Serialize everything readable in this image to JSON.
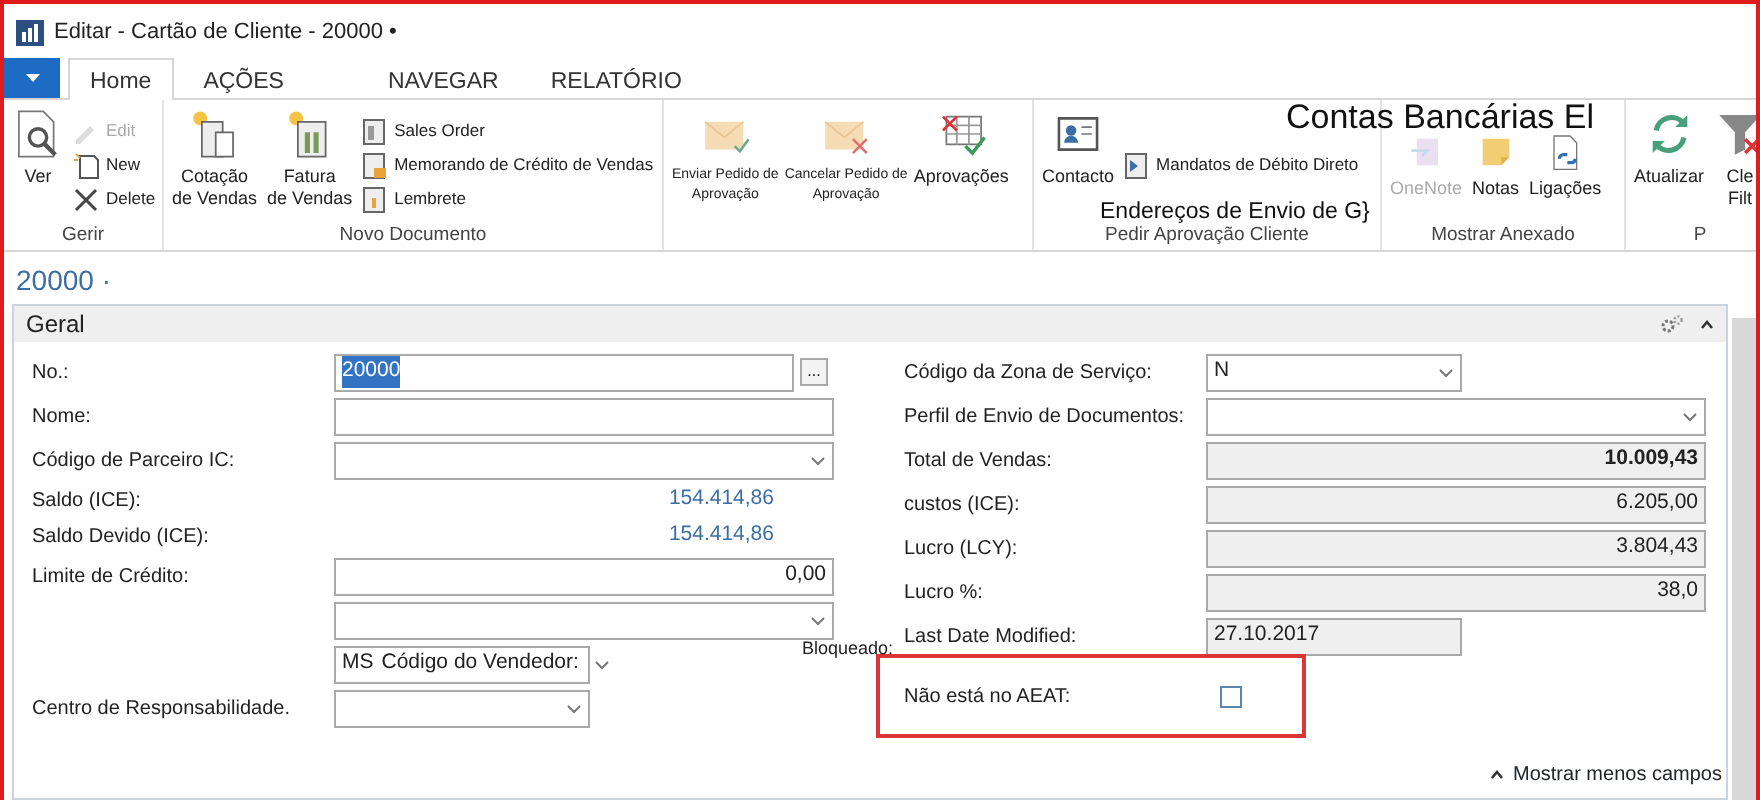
{
  "window": {
    "title": "Editar - Cartão de Cliente - 20000 •"
  },
  "ribbon_tabs": [
    {
      "label": "Home",
      "selected": true
    },
    {
      "label": "AÇÕES",
      "selected": false
    },
    {
      "label": "NAVEGAR",
      "selected": false
    },
    {
      "label": "RELATÓRIO",
      "selected": false
    }
  ],
  "ribbon_groups": [
    {
      "label": "Gerir",
      "items": [
        {
          "kind": "large",
          "lines": [
            "Ver"
          ],
          "disabled": false
        },
        {
          "kind": "small",
          "lines": [
            "Edit"
          ],
          "disabled": true
        },
        {
          "kind": "small",
          "lines": [
            "New"
          ],
          "disabled": false
        },
        {
          "kind": "small",
          "lines": [
            "Delete"
          ],
          "disabled": false
        }
      ]
    },
    {
      "label": "Novo Documento",
      "items": [
        {
          "kind": "large",
          "lines": [
            "Cotação",
            "de Vendas"
          ],
          "disabled": false
        },
        {
          "kind": "large",
          "lines": [
            "Fatura",
            "de Vendas"
          ],
          "disabled": false
        },
        {
          "kind": "small",
          "lines": [
            "Sales Order"
          ],
          "disabled": false
        },
        {
          "kind": "small",
          "lines": [
            "Memorando de Crédito de Vendas"
          ],
          "disabled": false
        },
        {
          "kind": "small",
          "lines": [
            "Lembrete"
          ],
          "disabled": false
        }
      ]
    },
    {
      "items": [
        {
          "kind": "large-fine",
          "lines": [
            "Enviar Pedido de",
            "Aprovação"
          ],
          "disabled": false
        },
        {
          "kind": "large-fine",
          "lines": [
            "Cancelar Pedido de",
            "Aprovação"
          ],
          "disabled": false
        },
        {
          "kind": "large",
          "lines": [
            "Aprovações"
          ],
          "disabled": false
        }
      ]
    },
    {
      "label": "Pedir Aprovação Cliente",
      "items": [
        {
          "kind": "large",
          "lines": [
            "Contacto"
          ],
          "disabled": false
        },
        {
          "kind": "small",
          "lines": [
            "Mandatos de Débito Direto"
          ],
          "disabled": false
        }
      ]
    },
    {
      "label": "Mostrar Anexado",
      "items": [
        {
          "kind": "large",
          "lines": [
            "OneNote"
          ],
          "disabled": true
        },
        {
          "kind": "large",
          "lines": [
            "Notas"
          ],
          "disabled": false
        },
        {
          "kind": "large",
          "lines": [
            "Ligações"
          ],
          "disabled": false
        }
      ]
    },
    {
      "label": "P",
      "items": [
        {
          "kind": "large",
          "lines": [
            "Atualizar"
          ],
          "disabled": false
        },
        {
          "kind": "large",
          "lines": [
            "Cle",
            "Filt"
          ],
          "disabled": false
        }
      ]
    }
  ],
  "ribbon_overlay_texts": [
    "Contas Bancárias El",
    "Endereços de Envio de G}"
  ],
  "page_title": "20000 ·",
  "panel": {
    "title": "Geral",
    "left_fields": [
      {
        "kind": "lookup",
        "label": "No.:",
        "value": "20000",
        "value_selected": true,
        "button": "..."
      },
      {
        "kind": "text",
        "label": "Nome:"
      },
      {
        "kind": "dropdown",
        "label": "Código de Parceiro IC:"
      },
      {
        "kind": "amount",
        "label": "Saldo (ICE):",
        "value": "154.414,86"
      },
      {
        "kind": "amount",
        "label": "Saldo Devido (ICE):",
        "value": "154.414,86"
      },
      {
        "kind": "number",
        "label": "Limite de Crédito:",
        "value": "0,00"
      },
      {
        "kind": "dropdown"
      },
      {
        "kind": "dropdown-short",
        "value": "MS",
        "inner_label": "Código do Vendedor:"
      },
      {
        "kind": "dropdown-short",
        "label": "Centro de Responsabilidade."
      }
    ],
    "right_fields": [
      {
        "kind": "dropdown-short",
        "label": "Código da Zona de Serviço:",
        "value": "N"
      },
      {
        "kind": "dropdown",
        "label": "Perfil de Envio de Documentos:"
      },
      {
        "kind": "readonly",
        "label": "Total de Vendas:",
        "value": "10.009,43",
        "bold": true
      },
      {
        "kind": "readonly",
        "label": "custos (ICE):",
        "value": "6.205,00"
      },
      {
        "kind": "readonly",
        "label": "Lucro (LCY):",
        "value": "3.804,43"
      },
      {
        "kind": "readonly",
        "label": "Lucro %:",
        "value": "38,0"
      },
      {
        "kind": "readonly-short",
        "label": "Last Date Modified:",
        "value": "27.10.2017"
      },
      {
        "kind": "checkbox",
        "label": "Não está no AEAT:",
        "checked": false,
        "highlighted": true
      }
    ],
    "stray_label": "Bloqueado:",
    "show_less": "Mostrar menos campos"
  }
}
